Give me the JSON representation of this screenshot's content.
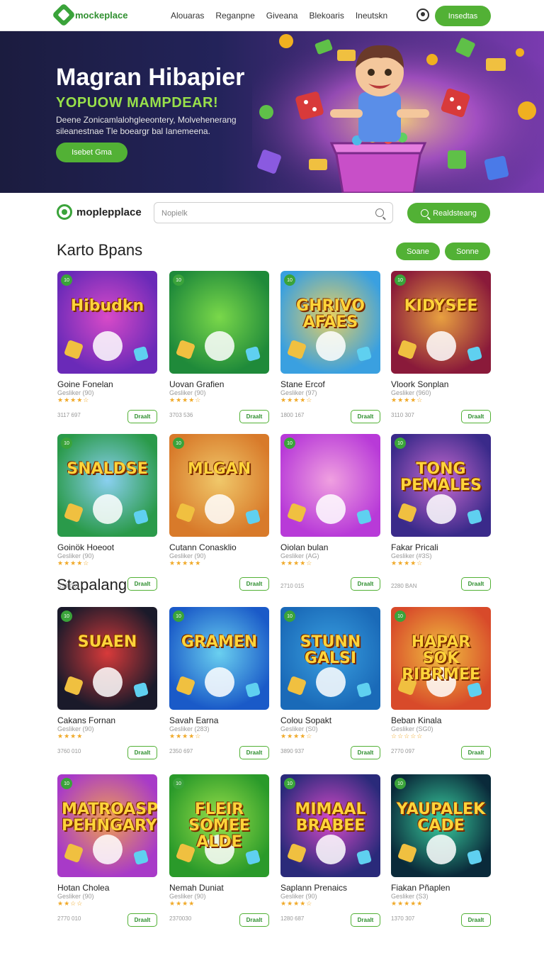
{
  "nav": {
    "logo_text": "mockeplace",
    "links": [
      "Alouaras",
      "Reganpne",
      "Giveana",
      "Blekoaris",
      "Ineutskn"
    ],
    "cta": "Insedtas"
  },
  "hero": {
    "title": "Magran Hibapier",
    "subtitle": "YOPUOW MAMPDEAR!",
    "description": "Deene Zonicamlalohgleeontery, Molvehenerang sileanestnae Tle boeargr bal Ianemeena.",
    "cta": "Isebet Gma"
  },
  "search": {
    "brand": "moplepplace",
    "placeholder": "Nopielk",
    "button": "Realdsteang"
  },
  "sections": [
    {
      "title": "Karto Bpans",
      "filters": [
        "Soane",
        "Sonne"
      ]
    },
    {
      "title": "Stapalang"
    }
  ],
  "games": [
    {
      "art": "Hibudkn",
      "name": "Goine Fonelan",
      "sub": "Gesliker (90)",
      "stars": "★★★★☆",
      "price": "3117 697",
      "button": "Draalt"
    },
    {
      "art": "",
      "name": "Uovan Grafien",
      "sub": "Gesliker (90)",
      "stars": "★★★★☆",
      "price": "3703 536",
      "button": "Draalt"
    },
    {
      "art": "GHRIVO AFAES",
      "name": "Stane Ercof",
      "sub": "Gesliker (97)",
      "stars": "★★★★☆",
      "price": "1800 167",
      "button": "Draalt"
    },
    {
      "art": "KIDYSEE",
      "name": "Vloork Sonplan",
      "sub": "Gesliker (960)",
      "stars": "★★★★☆",
      "price": "3110 307",
      "button": "Draalt"
    },
    {
      "art": "SNALDSE",
      "name": "Goinök Hoeoot",
      "sub": "Gesliker (90)",
      "stars": "★★★★☆",
      "price": "",
      "button": "Draalt"
    },
    {
      "art": "MLGAN",
      "name": "Cutann Conasklio",
      "sub": "Gesliker (90)",
      "stars": "★★★★★",
      "price": "",
      "button": "Draalt"
    },
    {
      "art": "",
      "name": "Oiolan bulan",
      "sub": "Gesliker (AG)",
      "stars": "★★★★☆",
      "price": "",
      "button": "Draalt"
    },
    {
      "art": "TONG PEMALES",
      "name": "Fakar Pricali",
      "sub": "Gesliker (#3S)",
      "stars": "★★★★☆",
      "price": "",
      "button": "Draalt"
    },
    {
      "art": "SUAEN",
      "name": "Cakans Fornan",
      "sub": "Gesliker (90)",
      "stars": "★★★★",
      "price": "3760 010",
      "button": "Draalt"
    },
    {
      "art": "GRAMEN",
      "name": "Savah Earna",
      "sub": "Gesliker (283)",
      "stars": "★★★★☆",
      "price": "2350 697",
      "button": "Draalt"
    },
    {
      "art": "STUNN GALSI",
      "name": "Colou Sopakt",
      "sub": "Gesliker (S0)",
      "stars": "★★★★☆",
      "price": "3890 937",
      "button": "Draalt"
    },
    {
      "art": "HAPAR SOK RIBRMEE",
      "name": "Beban Kinala",
      "sub": "Gesliker (SG0)",
      "stars": "☆☆☆☆☆",
      "price": "2770 097",
      "button": "Draalt"
    },
    {
      "art": "MATROASP PEHNGARY",
      "name": "Hotan Cholea",
      "sub": "Gesliker (90)",
      "stars": "★★☆☆",
      "price": "2770 010",
      "button": "Draalt"
    },
    {
      "art": "FLEIR SOMEE ALDE",
      "name": "Nemah Duniat",
      "sub": "Gesliker (90)",
      "stars": "★★★★",
      "price": "2370030",
      "button": "Draalt"
    },
    {
      "art": "MIMAAL BRABEE",
      "name": "Saplann Prenaics",
      "sub": "Gesliker (90)",
      "stars": "★★★★☆",
      "price": "1280 687",
      "button": "Draalt"
    },
    {
      "art": "YAUPALEK CADE",
      "name": "Fiakan Pñaplen",
      "sub": "Gesliker (S3)",
      "stars": "★★★★★",
      "price": "1370 307",
      "button": "Draalt"
    }
  ],
  "row2_prices": [
    "SS3 001",
    "",
    "2710 015",
    "2280 BAN"
  ]
}
